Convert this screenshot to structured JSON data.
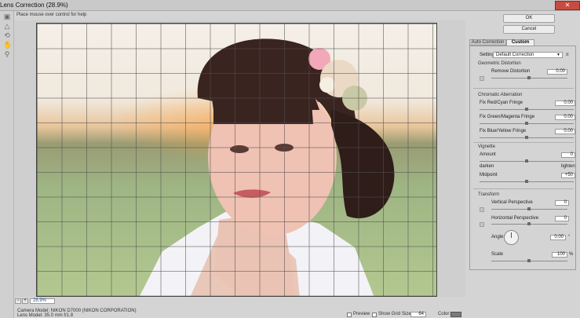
{
  "window": {
    "title": "Lens Correction (28.9%)"
  },
  "help_text": "Place mouse over control for help",
  "buttons": {
    "ok": "OK",
    "cancel": "Cancel"
  },
  "tabs": [
    {
      "label": "Auto Correction"
    },
    {
      "label": "Custom"
    }
  ],
  "settings": {
    "label": "Settings:",
    "value": "Default Correction"
  },
  "geometric": {
    "heading": "Geometric Distortion",
    "remove_label": "Remove Distortion",
    "remove_value": "0.00"
  },
  "chromatic": {
    "heading": "Chromatic Aberration",
    "red_label": "Fix Red/Cyan Fringe",
    "red_value": "0.00",
    "green_label": "Fix Green/Magenta Fringe",
    "green_value": "0.00",
    "blue_label": "Fix Blue/Yellow Fringe",
    "blue_value": "0.00"
  },
  "vignette": {
    "heading": "Vignette",
    "amount_label": "Amount",
    "amount_value": "0",
    "darken": "darken",
    "lighten": "lighten",
    "midpoint_label": "Midpoint",
    "midpoint_value": "+50"
  },
  "transform": {
    "heading": "Transform",
    "vertical_label": "Vertical Perspective",
    "vertical_value": "0",
    "horizontal_label": "Horizontal Perspective",
    "horizontal_value": "0",
    "angle_label": "Angle:",
    "angle_value": "0.00",
    "angle_unit": "°",
    "scale_label": "Scale",
    "scale_value": "100",
    "scale_unit": "%"
  },
  "zoom": {
    "value": "28.9%",
    "minus": "−",
    "plus": "+"
  },
  "camera": {
    "model": "Camera Model: NIKON D7000 (NIKON CORPORATION)",
    "lens": "Lens Model: 35.0 mm f/1.8"
  },
  "options": {
    "preview": "Preview",
    "show_grid": "Show Grid",
    "size_label": "Size:",
    "size_value": "64",
    "color_label": "Color:"
  }
}
